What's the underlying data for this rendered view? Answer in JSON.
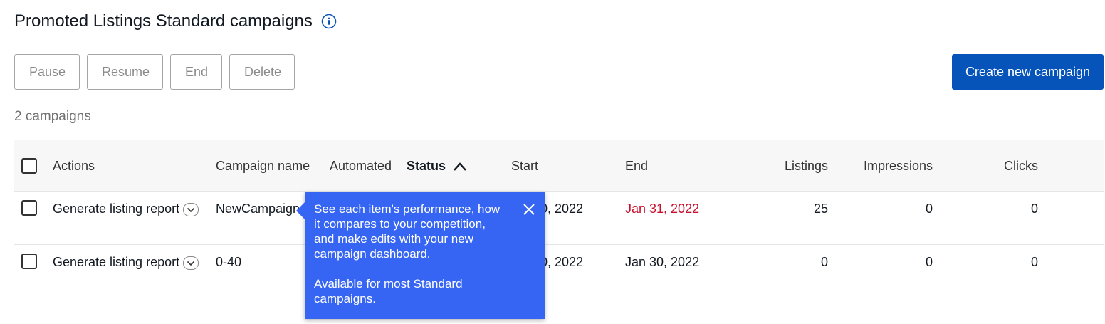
{
  "header": {
    "title": "Promoted Listings Standard campaigns"
  },
  "toolbar": {
    "pause": "Pause",
    "resume": "Resume",
    "end": "End",
    "delete": "Delete",
    "create": "Create new campaign"
  },
  "summary": {
    "count": "2 campaigns"
  },
  "table": {
    "headers": {
      "actions": "Actions",
      "campaign_name": "Campaign name",
      "automated": "Automated",
      "status": "Status",
      "start": "Start",
      "end": "End",
      "listings": "Listings",
      "impressions": "Impressions",
      "clicks": "Clicks"
    },
    "rows": [
      {
        "action": "Generate listing report",
        "name": "NewCampaign",
        "start": "0, 2022",
        "end": "Jan 31, 2022",
        "listings": "25",
        "impressions": "0",
        "clicks": "0"
      },
      {
        "action": "Generate listing report",
        "name": "0-40",
        "start": "0, 2022",
        "end": "Jan 30, 2022",
        "listings": "0",
        "impressions": "0",
        "clicks": "0"
      }
    ]
  },
  "tooltip": {
    "line1": "See each item's performance, how",
    "line2": "it compares to your competition,",
    "line3": "and make edits with your new",
    "line4": "campaign dashboard.",
    "line5": "Available for most Standard",
    "line6": "campaigns."
  },
  "colors": {
    "primary": "#0654ba",
    "tooltip": "#3665f3",
    "warning": "#c8102e"
  },
  "icons": {
    "info": "info-icon",
    "sort": "chevron-up-icon",
    "dropdown": "chevron-down-icon",
    "close": "close-icon"
  }
}
